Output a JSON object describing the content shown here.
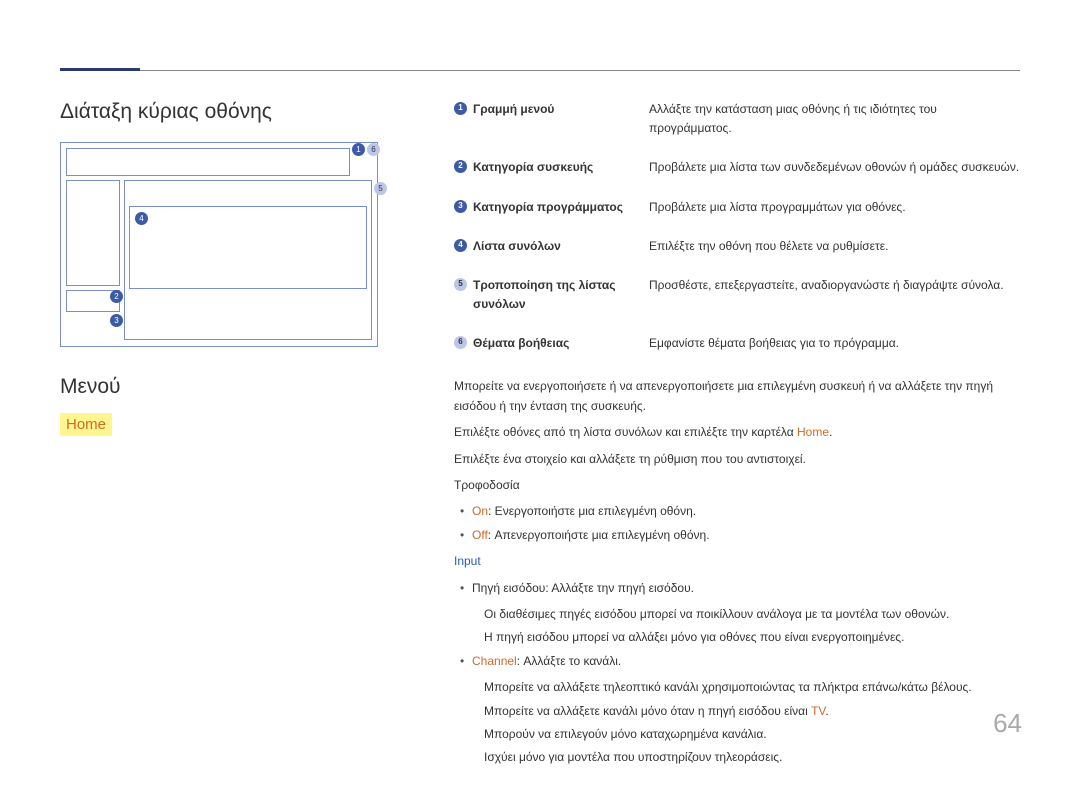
{
  "page_number": "64",
  "section_title": "Διάταξη κύριας οθόνης",
  "menu_heading": "Μενού",
  "home_tab": "Home",
  "diagram": {
    "bullets": {
      "b1": "1",
      "b2": "2",
      "b3": "3",
      "b4": "4",
      "b5": "5",
      "b6": "6"
    }
  },
  "legend": [
    {
      "num": "1",
      "label": "Γραμμή μενού",
      "desc": "Αλλάξτε την κατάσταση μιας οθόνης ή τις ιδιότητες του προγράμματος."
    },
    {
      "num": "2",
      "label": "Κατηγορία συσκευής",
      "desc": "Προβάλετε μια λίστα των συνδεδεμένων οθονών ή ομάδες συσκευών."
    },
    {
      "num": "3",
      "label": "Κατηγορία προγράμματος",
      "desc": "Προβάλετε μια λίστα προγραμμάτων για οθόνες."
    },
    {
      "num": "4",
      "label": "Λίστα συνόλων",
      "desc": "Επιλέξτε την οθόνη που θέλετε να ρυθμίσετε."
    },
    {
      "num": "5",
      "label": "Τροποποίηση της λίστας συνόλων",
      "desc": "Προσθέστε, επεξεργαστείτε, αναδιοργανώστε ή διαγράψτε σύνολα.",
      "light": true
    },
    {
      "num": "6",
      "label": "Θέματα βοήθειας",
      "desc": "Εμφανίστε θέματα βοήθειας για το πρόγραμμα.",
      "light": true
    }
  ],
  "body": {
    "p1": "Μπορείτε να ενεργοποιήσετε ή να απενεργοποιήσετε μια επιλεγμένη συσκευή ή να αλλάξετε την πηγή εισόδου ή την ένταση της συσκευής.",
    "p2_a": "Επιλέξτε οθόνες από τη λίστα συνόλων και επιλέξτε την καρτέλα ",
    "p2_home": "Home",
    "p2_b": ".",
    "p3": "Επιλέξτε ένα στοιχείο και αλλάξετε τη ρύθμιση που του αντιστοιχεί.",
    "power_label": "Τροφοδοσία",
    "power_on_label": "On",
    "power_on_text": ": Ενεργοποιήστε μια επιλεγμένη οθόνη.",
    "power_off_label": "Off",
    "power_off_text": ": Απενεργοποιήστε μια επιλεγμένη οθόνη.",
    "input_label": "Input",
    "input_source": "Πηγή εισόδου: Αλλάξτε την πηγή εισόδου.",
    "input_note1": "Οι διαθέσιμες πηγές εισόδου μπορεί να ποικίλλουν ανάλογα με τα μοντέλα των οθονών.",
    "input_note2": "Η πηγή εισόδου μπορεί να αλλάξει μόνο για οθόνες που είναι ενεργοποιημένες.",
    "channel_label": "Channel",
    "channel_text": ": Αλλάξτε το κανάλι.",
    "channel_n1": "Μπορείτε να αλλάξετε τηλεοπτικό κανάλι χρησιμοποιώντας τα πλήκτρα επάνω/κάτω βέλους.",
    "channel_n2_a": "Μπορείτε να αλλάξετε κανάλι μόνο όταν η πηγή εισόδου είναι ",
    "channel_n2_tv": "TV",
    "channel_n2_b": ".",
    "channel_n3": "Μπορούν να επιλεγούν μόνο καταχωρημένα κανάλια.",
    "channel_n4": "Ισχύει μόνο για μοντέλα που υποστηρίζουν τηλεοράσεις."
  }
}
